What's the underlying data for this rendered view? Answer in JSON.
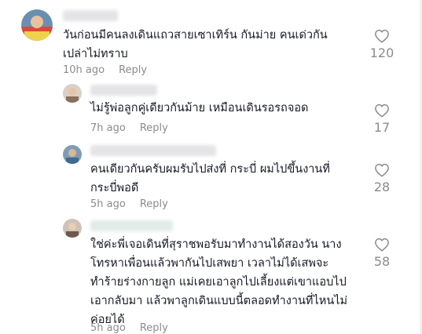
{
  "comments": [
    {
      "text": "วันก่อนมีคนลงเดินแถวสายเซาเทิร์น กันม่าย คนเด่วกัน เปล่าไม่ทราบ",
      "time": "10h ago",
      "reply": "Reply",
      "likes": "120",
      "avatar_color": "#c9a98a"
    },
    {
      "text": "ไม่รู้พ่อลูกคู่เดียวกันม้าย เหมือนเดินรอรถจอด",
      "time": "7h ago",
      "reply": "Reply",
      "likes": "17",
      "avatar_color": "#b7a79a"
    },
    {
      "text": "คนเดียวกันครับผมรับไปส่งที่ กระบี่ ผมไปขึ้นงานที่ กระบี่พอดี",
      "time": "5h ago",
      "reply": "Reply",
      "likes": "28",
      "avatar_color": "#7f9cb5"
    },
    {
      "text": "ใช่ค่ะพี่เจอเดินที่สุราชพอรับมาทำงานได้สองวัน นางโทรหาเพื่อนแล้วพากันไปเสพยา เวลาไม่ได้เสพจะทำร้ายร่างกายลูก แม่เคยเอาลูกไปเลี้ยงแต่เขาแอบไปเอากลับมา แล้วพาลูกเดินแบบนี้ตลอดทำงานที่ไหนไม่ค่อยได้",
      "time": "5h ago",
      "reply": "Reply",
      "likes": "58",
      "avatar_color": "#c4b3a8"
    }
  ],
  "icons": {
    "like": "heart-outline-icon"
  },
  "colors": {
    "text": "#161823",
    "meta": "#8a8b91",
    "background": "#ffffff"
  }
}
